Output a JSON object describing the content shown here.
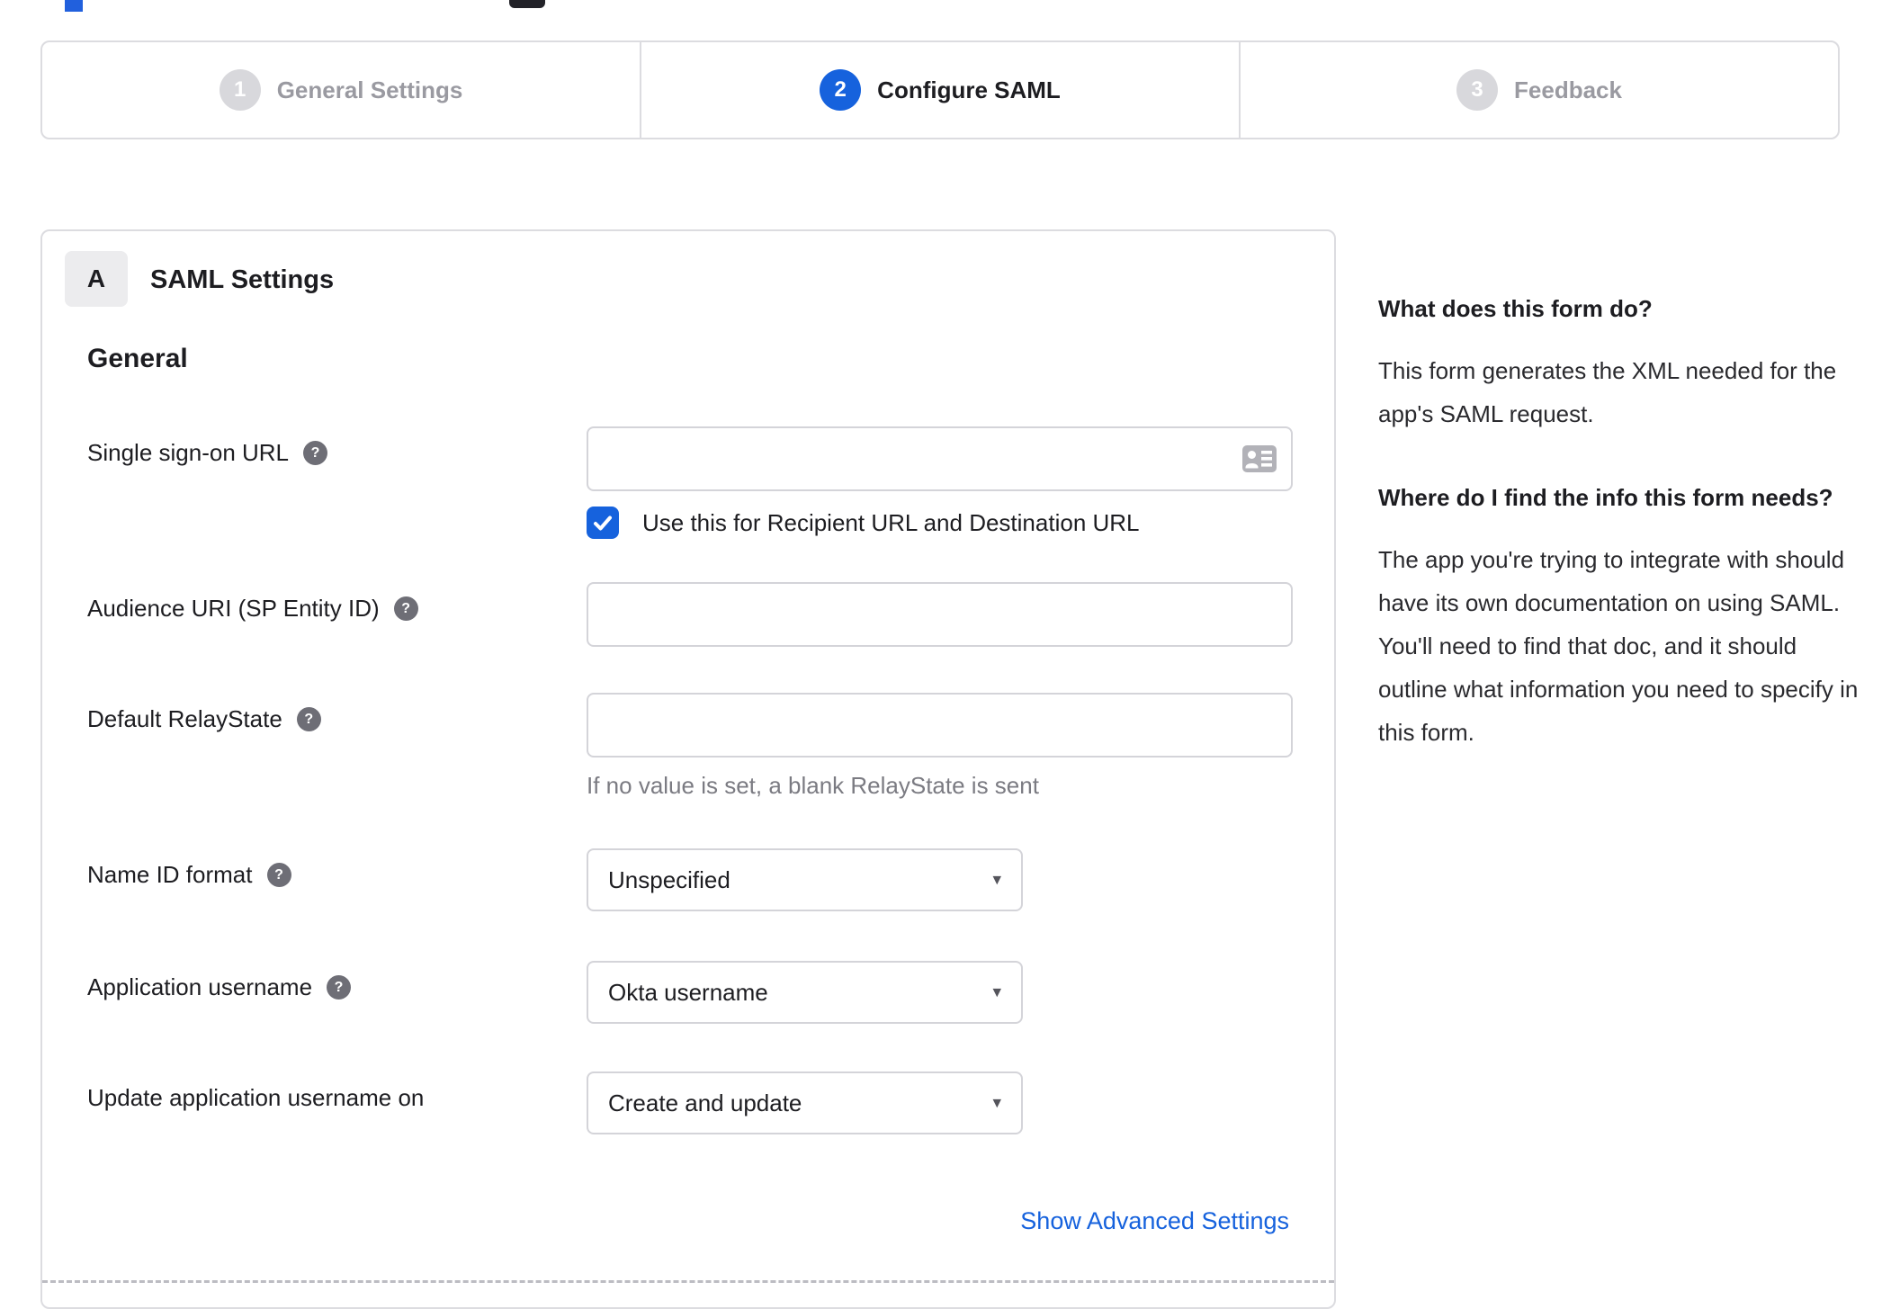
{
  "wizard_steps": {
    "steps": [
      {
        "number": "1",
        "label": "General Settings",
        "state": "inactive"
      },
      {
        "number": "2",
        "label": "Configure SAML",
        "state": "active"
      },
      {
        "number": "3",
        "label": "Feedback",
        "state": "inactive"
      }
    ]
  },
  "saml_panel": {
    "badge": "A",
    "title": "SAML Settings",
    "section": "General",
    "fields": {
      "sso_url": {
        "label": "Single sign-on URL",
        "value": "",
        "checkbox_label": "Use this for Recipient URL and Destination URL",
        "checkbox_checked": true
      },
      "audience_uri": {
        "label": "Audience URI (SP Entity ID)",
        "value": ""
      },
      "default_relay_state": {
        "label": "Default RelayState",
        "value": "",
        "hint": "If no value is set, a blank RelayState is sent"
      },
      "name_id_format": {
        "label": "Name ID format",
        "value": "Unspecified"
      },
      "application_username": {
        "label": "Application username",
        "value": "Okta username"
      },
      "update_application_username_on": {
        "label": "Update application username on",
        "value": "Create and update"
      }
    },
    "advanced_link": "Show Advanced Settings"
  },
  "help_sidebar": {
    "sections": [
      {
        "title": "What does this form do?",
        "body": "This form generates the XML needed for the app's SAML request."
      },
      {
        "title": "Where do I find the info this form needs?",
        "body": "The app you're trying to integrate with should have its own documentation on using SAML. You'll need to find that doc, and it should outline what information you need to specify in this form."
      }
    ]
  },
  "icons": {
    "help_glyph": "?",
    "dropdown_arrow": "▾"
  },
  "colors": {
    "primary_blue": "#1662dd",
    "border_gray": "#dcdce0",
    "inactive_gray": "#9a9aa1",
    "text_dark": "#1d1d21",
    "hint_gray": "#7b7b82"
  }
}
